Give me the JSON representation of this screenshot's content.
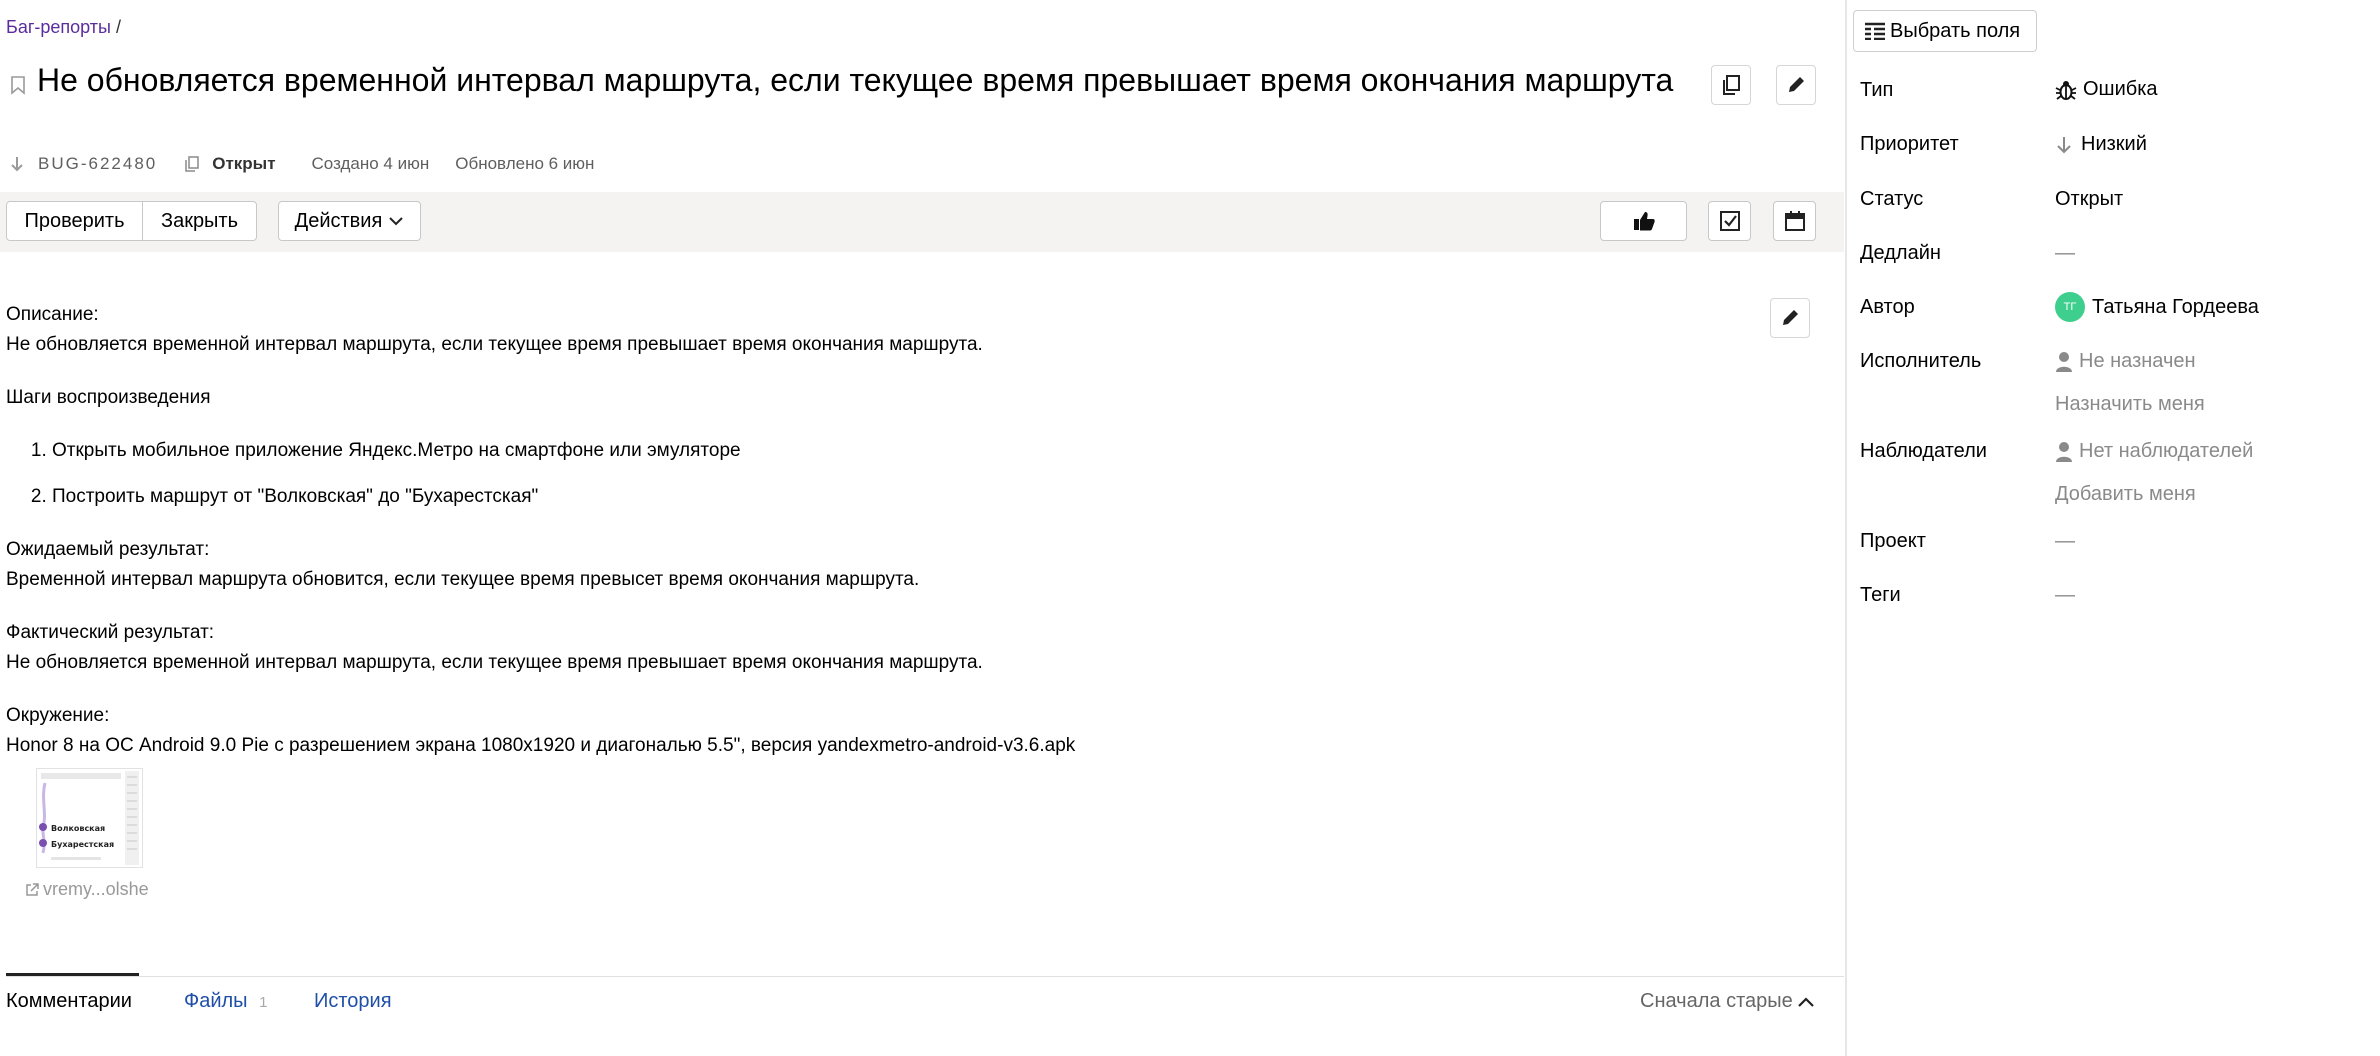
{
  "breadcrumb": {
    "parent": "Баг-репорты",
    "sep": " /"
  },
  "issue": {
    "title": "Не обновляется временной интервал маршрута, если текущее время превышает время окончания маршрута",
    "key": "BUG-622480",
    "status": "Открыт",
    "created": "Создано 4 июн",
    "updated": "Обновлено 6 июн"
  },
  "toolbar": {
    "check_label": "Проверить",
    "close_label": "Закрыть",
    "actions_label": "Действия"
  },
  "description": {
    "desc_heading": "Описание:",
    "desc_text": "Не обновляется временной интервал маршрута, если текущее время превышает время окончания маршрута.",
    "steps_heading": "Шаги воспроизведения",
    "steps": [
      "Открыть мобильное приложение Яндекс.Метро на смартфоне или эмуляторе",
      "Построить маршрут от \"Волковская\" до \"Бухарестская\""
    ],
    "expected_heading": "Ожидаемый результат:",
    "expected_text": "Временной интервал маршрута обновится, если текущее время превысет время окончания маршрута.",
    "actual_heading": "Фактический результат:",
    "actual_text": "Не обновляется временной интервал маршрута, если текущее время превышает время окончания маршрута.",
    "env_heading": "Окружение:",
    "env_text": "Honor 8 на ОС Android 9.0 Pie с разрешением экрана 1080x1920 и диагональю 5.5\", версия yandexmetro-android-v3.6.apk"
  },
  "attachment": {
    "name": "vremy...olshe",
    "station1": "Волковская",
    "station2": "Бухарестская"
  },
  "tabs": {
    "comments": "Комментарии",
    "files": "Файлы",
    "files_count": "1",
    "history": "История",
    "sort": "Сначала старые"
  },
  "sidebar": {
    "select_fields": "Выбрать поля",
    "type_label": "Тип",
    "type_value": "Ошибка",
    "priority_label": "Приоритет",
    "priority_value": "Низкий",
    "status_label": "Статус",
    "status_value": "Открыт",
    "deadline_label": "Дедлайн",
    "deadline_value": "—",
    "author_label": "Автор",
    "author_initials": "ТГ",
    "author_name": "Татьяна Гордеева",
    "assignee_label": "Исполнитель",
    "assignee_value": "Не назначен",
    "assign_me": "Назначить меня",
    "watchers_label": "Наблюдатели",
    "watchers_value": "Нет наблюдателей",
    "add_me": "Добавить меня",
    "project_label": "Проект",
    "project_value": "—",
    "tags_label": "Теги",
    "tags_value": "—"
  },
  "colors": {
    "link": "#1f4fa6",
    "breadcrumb": "#5a2d9e",
    "avatar": "#3ecf8e",
    "panel_bg": "#f4f3f1"
  }
}
